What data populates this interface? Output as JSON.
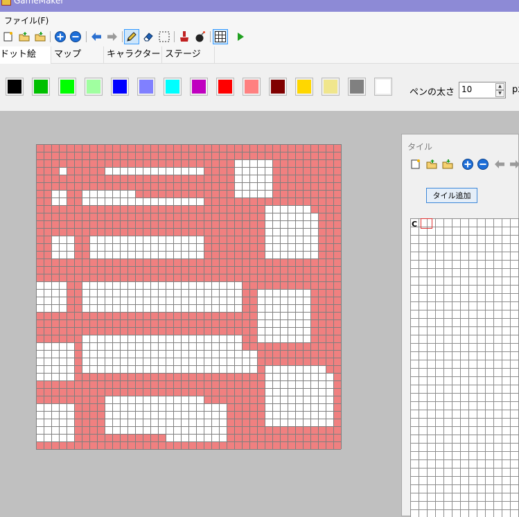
{
  "window": {
    "title": "GameMaker"
  },
  "menu": {
    "file": "ファイル(F)"
  },
  "toolbar": {
    "buttons": [
      "new-icon",
      "open-icon",
      "save-icon",
      "zoom-in-icon",
      "zoom-out-icon",
      "undo-icon",
      "redo-icon",
      "pencil-icon",
      "eraser-icon",
      "select-rect-icon",
      "fill-icon",
      "bomb-icon",
      "grid-icon",
      "play-icon"
    ],
    "active": "pencil-icon"
  },
  "tabs": [
    "ドット絵",
    "マップ",
    "キャラクター",
    "ステージ"
  ],
  "palette": {
    "colors": [
      "#000000",
      "#00c000",
      "#00ff00",
      "#a0ffa0",
      "#0000ff",
      "#8080ff",
      "#00ffff",
      "#c000c0",
      "#ff0000",
      "#ff8080",
      "#800000",
      "#ffd700",
      "#f0e68c",
      "#808080",
      "#ffffff"
    ],
    "pen_label": "ペンの太さ",
    "pen_value": "10",
    "pen_unit": "px",
    "spin_up": "▲",
    "spin_down": "▼"
  },
  "canvas": {
    "cols": 40,
    "rows": 40,
    "fill_color": "#f08080",
    "line_color": "#7f7f7f",
    "blank_color": "#ffffff",
    "rows_map": [
      "1111111111111111111111111111111111111111",
      "1111111111111111111111111111111111111111",
      "1111111111111111111111111111111111111111",
      "1111111111111111111111111111111111111111",
      "1111111111111111111111111111111111111111",
      "1111111111111111111111111111111111111111",
      "1111111111111111111111111111111111111111",
      "1111111111111111111111111111111111111111",
      "1111111111111111111111111111111111111111",
      "1111111111111111111111111111111111111111",
      "1111111111111111111111111111111111111111",
      "1111111111111111111111111111111111111111",
      "1111111111111111111111111111111111111111",
      "1111111111111111111111111111111111111111",
      "1111111111111111111111111111111111111111",
      "1111111111111111111111111111111111111111",
      "1111111111111111111111111111111111111111",
      "1111111111111111111111111111111111111111",
      "1111111111111111111111111111111111111111",
      "1111111111111111111111111111111111111111",
      "1111111111111111111111111111111111111111",
      "1111111111111111111111111111111111111111",
      "1111111111111111111111111111111111111111",
      "1111111111111111111111111111111111111111",
      "1111111111111111111111111111111111111111",
      "1111111111111111111111111111111111111111",
      "1111111111111111111111111111111111111111",
      "1111111111111111111111111111111111111111",
      "1111111111111111111111111111111111111111",
      "1111111111111111111111111111111111111111",
      "1111111111111111111111111111111111111111",
      "1111111111111111111111111111111111111111",
      "1111111111111111111111111111111111111111",
      "1111111111111111111111111111111111111111",
      "1111111111111111111111111111111111111111",
      "1111111111111111111111111111111111111111",
      "1111111111111111111111111111111111111111",
      "1111111111111111111111111111111111111111",
      "1111111111111111111111111111111111111111",
      "1111111111111111111111111111111111111111"
    ],
    "blank_rects": [
      [
        3,
        3,
        1,
        1
      ],
      [
        9,
        3,
        13,
        1
      ],
      [
        26,
        2,
        5,
        5
      ],
      [
        2,
        6,
        2,
        2
      ],
      [
        6,
        6,
        7,
        2
      ],
      [
        11,
        7,
        11,
        1
      ],
      [
        30,
        8,
        6,
        1
      ],
      [
        30,
        9,
        7,
        6
      ],
      [
        2,
        12,
        3,
        3
      ],
      [
        7,
        12,
        15,
        3
      ],
      [
        0,
        18,
        4,
        4
      ],
      [
        6,
        18,
        21,
        4
      ],
      [
        29,
        19,
        7,
        2
      ],
      [
        29,
        21,
        7,
        5
      ],
      [
        6,
        25,
        21,
        2
      ],
      [
        0,
        26,
        5,
        5
      ],
      [
        6,
        27,
        23,
        3
      ],
      [
        30,
        29,
        8,
        1
      ],
      [
        30,
        30,
        9,
        7
      ],
      [
        9,
        33,
        13,
        1
      ],
      [
        0,
        34,
        5,
        5
      ],
      [
        9,
        34,
        16,
        4
      ],
      [
        17,
        38,
        8,
        1
      ]
    ]
  },
  "tile_panel": {
    "title": "タイル",
    "toolbar": [
      "new-icon",
      "open-icon",
      "save-icon",
      "zoom-in-icon",
      "zoom-out-icon",
      "undo-icon",
      "redo-icon"
    ],
    "add_button": "タイル追加",
    "corner_label": "C",
    "grid_cols": 13,
    "grid_rows": 36
  }
}
